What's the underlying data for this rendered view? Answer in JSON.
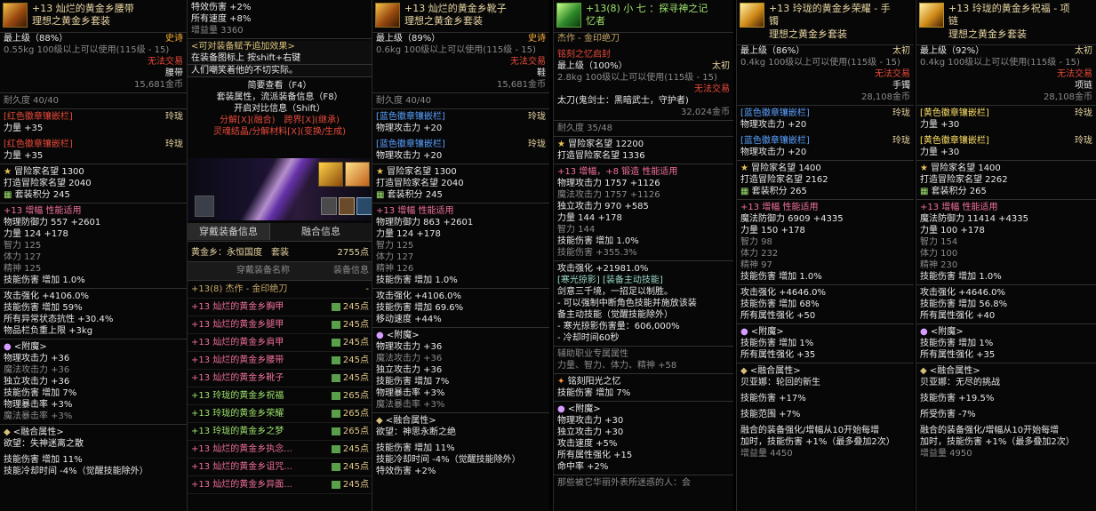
{
  "colors": {
    "background": "#070707",
    "title": "#e9d6a3",
    "red": "#e84a3a",
    "pink": "#f06f9a",
    "green": "#9ee36e",
    "blue": "#5aa0ff",
    "epic": "#ffb23a",
    "teal": "#9ad7c8"
  },
  "panels": [
    {
      "icon": "belt-icon",
      "title": "+13 灿烂的黄金乡腰带",
      "subtitle": "理想之黄金乡套装",
      "lines": [
        {
          "t": "最上级（88%）",
          "c": "white",
          "r": "史诗",
          "rc": "epic"
        },
        {
          "t": "0.55kg 100级以上可以使用(115级 - 15)",
          "c": "grey"
        },
        {
          "t": "",
          "r": "无法交易",
          "rc": "red"
        },
        {
          "t": "",
          "r": "腰带",
          "rc": "white"
        },
        {
          "t": "",
          "r": "15,681金币",
          "rc": "grey"
        },
        {
          "sep": true
        },
        {
          "t": "耐久度 40/40",
          "c": "grey"
        },
        {
          "sep": true
        },
        {
          "t": "[红色徽章镶嵌栏]",
          "c": "red",
          "r": "玲珑",
          "rc": "title"
        },
        {
          "t": "力量 +35",
          "c": "white"
        },
        {
          "gap": true
        },
        {
          "t": "[红色徽章镶嵌栏]",
          "c": "red",
          "r": "玲珑",
          "rc": "title"
        },
        {
          "t": "力量 +35",
          "c": "white"
        },
        {
          "sep": true
        },
        {
          "t": "冒险家名望 1300",
          "c": "white",
          "s": 1
        },
        {
          "t": "   打造冒险家名望 2040",
          "c": "white"
        },
        {
          "t": "套装积分 245",
          "c": "white",
          "s": 2
        },
        {
          "sep": true
        },
        {
          "t": "+13 增幅 性能适用",
          "c": "pink"
        },
        {
          "t": "物理防御力 557 +2601",
          "c": "white"
        },
        {
          "t": "力量 124 +178",
          "c": "white"
        },
        {
          "t": "智力 125",
          "c": "grey"
        },
        {
          "t": "体力 127",
          "c": "grey"
        },
        {
          "t": "精神 125",
          "c": "grey"
        },
        {
          "t": "技能伤害 增加 1.0%",
          "c": "white"
        },
        {
          "sep": true
        },
        {
          "t": "攻击强化 +4106.0%",
          "c": "white"
        },
        {
          "t": "技能伤害 增加 59%",
          "c": "white"
        },
        {
          "t": "所有异常状态抗性 +30.4%",
          "c": "white"
        },
        {
          "t": "物品栏负重上限 +3kg",
          "c": "white"
        },
        {
          "sep": true
        },
        {
          "t": "<附魔>",
          "c": "white",
          "s": 3
        },
        {
          "t": "物理攻击力 +36",
          "c": "white"
        },
        {
          "t": "魔法攻击力 +36",
          "c": "grey"
        },
        {
          "t": "独立攻击力 +36",
          "c": "white"
        },
        {
          "t": "技能伤害 增加 7%",
          "c": "white"
        },
        {
          "t": "物理暴击率 +3%",
          "c": "white"
        },
        {
          "t": "魔法暴击率 +3%",
          "c": "grey"
        },
        {
          "sep": true
        },
        {
          "t": "<融合属性>",
          "c": "white",
          "s": 4
        },
        {
          "t": "   欲望：失神迷离之散",
          "c": "white"
        },
        {
          "gap": true
        },
        {
          "t": "技能伤害 增加 11%",
          "c": "white"
        },
        {
          "t": "技能冷却时间 -4%（觉醒技能除外）",
          "c": "white"
        }
      ]
    },
    {
      "icon": "boots-icon",
      "title": "+13 灿烂的黄金乡靴子",
      "subtitle": "理想之黄金乡套装",
      "lines": [
        {
          "t": "最上级（89%）",
          "c": "white",
          "r": "史诗",
          "rc": "epic"
        },
        {
          "t": "0.6kg 100级以上可以使用(115级 - 15)",
          "c": "grey"
        },
        {
          "t": "",
          "r": "无法交易",
          "rc": "red"
        },
        {
          "t": "",
          "r": "鞋",
          "rc": "white"
        },
        {
          "t": "",
          "r": "15,681金币",
          "rc": "grey"
        },
        {
          "sep": true
        },
        {
          "t": "耐久度 40/40",
          "c": "grey"
        },
        {
          "sep": true
        },
        {
          "t": "[蓝色徽章镶嵌栏]",
          "c": "blue",
          "r": "玲珑",
          "rc": "title"
        },
        {
          "t": "物理攻击力 +20",
          "c": "white"
        },
        {
          "gap": true
        },
        {
          "t": "[蓝色徽章镶嵌栏]",
          "c": "blue",
          "r": "玲珑",
          "rc": "title"
        },
        {
          "t": "物理攻击力 +20",
          "c": "white"
        },
        {
          "sep": true
        },
        {
          "t": "冒险家名望 1300",
          "c": "white",
          "s": 1
        },
        {
          "t": "   打造冒险家名望 2040",
          "c": "white"
        },
        {
          "t": "套装积分 245",
          "c": "white",
          "s": 2
        },
        {
          "sep": true
        },
        {
          "t": "+13 增幅 性能适用",
          "c": "pink"
        },
        {
          "t": "物理防御力 863 +2601",
          "c": "white"
        },
        {
          "t": "力量 124 +178",
          "c": "white"
        },
        {
          "t": "智力 125",
          "c": "grey"
        },
        {
          "t": "体力 127",
          "c": "grey"
        },
        {
          "t": "精神 126",
          "c": "grey"
        },
        {
          "t": "技能伤害 增加 1.0%",
          "c": "white"
        },
        {
          "sep": true
        },
        {
          "t": "攻击强化 +4106.0%",
          "c": "white"
        },
        {
          "t": "技能伤害 增加 69.6%",
          "c": "white"
        },
        {
          "t": "移动速度 +44%",
          "c": "white"
        },
        {
          "sep": true
        },
        {
          "t": "<附魔>",
          "c": "white",
          "s": 3
        },
        {
          "t": "物理攻击力 +36",
          "c": "white"
        },
        {
          "t": "魔法攻击力 +36",
          "c": "grey"
        },
        {
          "t": "独立攻击力 +36",
          "c": "white"
        },
        {
          "t": "技能伤害 增加 7%",
          "c": "white"
        },
        {
          "t": "物理暴击率 +3%",
          "c": "white"
        },
        {
          "t": "魔法暴击率 +3%",
          "c": "grey"
        },
        {
          "sep": true
        },
        {
          "t": "<融合属性>",
          "c": "white",
          "s": 4
        },
        {
          "t": "   欲望：神思永断之绝",
          "c": "white"
        },
        {
          "gap": true
        },
        {
          "t": "技能伤害 增加 11%",
          "c": "white"
        },
        {
          "t": "技能冷却时间 -4%（觉醒技能除外）",
          "c": "white"
        },
        {
          "t": "特效伤害 +2%",
          "c": "white"
        }
      ]
    },
    {
      "icon": "weapon-icon",
      "title": "+13(8) 小 七 ：探寻神之记",
      "subtitle": "忆者",
      "lines": [
        {
          "t": "   杰作 - 金印绝刀",
          "c": "tan"
        },
        {
          "gap": true
        },
        {
          "t": "   铭刻之忆启封",
          "c": "red"
        },
        {
          "t": "最上级（100%）",
          "c": "white",
          "r": "太初",
          "rc": "title"
        },
        {
          "t": "2.8kg 100级以上可以使用(115级 - 15)",
          "c": "grey"
        },
        {
          "t": "",
          "r": "无法交易",
          "rc": "red"
        },
        {
          "t": "太刀(鬼剑士：黑暗武士，守护者)",
          "c": "white"
        },
        {
          "t": "",
          "r": "32,024金币",
          "rc": "grey"
        },
        {
          "sep": true
        },
        {
          "t": "耐久度 35/48",
          "c": "grey"
        },
        {
          "sep": true
        },
        {
          "t": "冒险家名望 12200",
          "c": "white",
          "s": 1
        },
        {
          "t": "   打造冒险家名望 1336",
          "c": "white"
        },
        {
          "sep": true
        },
        {
          "t": "+13 增幅，+8 锻造 性能适用",
          "c": "pink"
        },
        {
          "t": "物理攻击力 1757 +1126",
          "c": "white"
        },
        {
          "t": "魔法攻击力 1757 +1126",
          "c": "grey"
        },
        {
          "t": "独立攻击力 970 +585",
          "c": "white"
        },
        {
          "t": "力量 144 +178",
          "c": "white"
        },
        {
          "t": "智力 144",
          "c": "grey"
        },
        {
          "t": "技能伤害 增加 1.0%",
          "c": "white"
        },
        {
          "t": "技能伤害 +355.3%",
          "c": "grey"
        },
        {
          "sep": true
        },
        {
          "t": "攻击强化 +21981.0%",
          "c": "white"
        },
        {
          "t": "[寒光掠影] [装备主动技能]",
          "c": "teal"
        },
        {
          "t": "剑意三千境，一招足以制胜。",
          "c": "white"
        },
        {
          "t": "- 可以强制中断角色技能并施放该装",
          "c": "white"
        },
        {
          "t": "备主动技能（觉醒技能除外）",
          "c": "white"
        },
        {
          "t": "- 寒光掠影伤害量：606,000%",
          "c": "white"
        },
        {
          "t": "- 冷却时间60秒",
          "c": "white"
        },
        {
          "sep": true
        },
        {
          "t": "辅助职业专属属性",
          "c": "grey"
        },
        {
          "t": "力量、智力、体力、精神 +58",
          "c": "grey"
        },
        {
          "sep": true
        },
        {
          "t": "铭刻阳光之忆",
          "c": "white",
          "s": 5
        },
        {
          "t": "技能伤害 增加 7%",
          "c": "white"
        },
        {
          "sep": true
        },
        {
          "t": "<附魔>",
          "c": "white",
          "s": 3
        },
        {
          "t": "物理攻击力 +30",
          "c": "white"
        },
        {
          "t": "独立攻击力 +30",
          "c": "white"
        },
        {
          "t": "攻击速度 +5%",
          "c": "white"
        },
        {
          "t": "所有属性强化 +15",
          "c": "white"
        },
        {
          "t": "命中率 +2%",
          "c": "white"
        },
        {
          "sep": true
        },
        {
          "t": "那些被它华丽外表所迷惑的人：会",
          "c": "grey"
        }
      ]
    },
    {
      "icon": "bracelet-icon",
      "title": "+13 玲珑的黄金乡荣耀 - 手",
      "subtitle": "镯",
      "subtitle2": "理想之黄金乡套装",
      "lines": [
        {
          "t": "最上级（86%）",
          "c": "white",
          "r": "太初",
          "rc": "title"
        },
        {
          "t": "0.4kg 100级以上可以使用(115级 - 15)",
          "c": "grey"
        },
        {
          "t": "",
          "r": "无法交易",
          "rc": "red"
        },
        {
          "t": "",
          "r": "手镯",
          "rc": "white"
        },
        {
          "t": "",
          "r": "28,108金币",
          "rc": "grey"
        },
        {
          "sep": true
        },
        {
          "t": "[蓝色徽章镶嵌栏]",
          "c": "blue",
          "r": "玲珑",
          "rc": "title"
        },
        {
          "t": "物理攻击力 +20",
          "c": "white"
        },
        {
          "gap": true
        },
        {
          "t": "[蓝色徽章镶嵌栏]",
          "c": "blue",
          "r": "玲珑",
          "rc": "title"
        },
        {
          "t": "物理攻击力 +20",
          "c": "white"
        },
        {
          "sep": true
        },
        {
          "t": "冒险家名望 1400",
          "c": "white",
          "s": 1
        },
        {
          "t": "   打造冒险家名望 2162",
          "c": "white"
        },
        {
          "t": "套装积分 265",
          "c": "white",
          "s": 2
        },
        {
          "sep": true
        },
        {
          "t": "+13 增幅 性能适用",
          "c": "pink"
        },
        {
          "t": "魔法防御力 6909 +4335",
          "c": "white"
        },
        {
          "t": "力量 150 +178",
          "c": "white"
        },
        {
          "t": "智力 98",
          "c": "grey"
        },
        {
          "t": "体力 232",
          "c": "grey"
        },
        {
          "t": "精神 97",
          "c": "grey"
        },
        {
          "t": "技能伤害 增加 1.0%",
          "c": "white"
        },
        {
          "sep": true
        },
        {
          "t": "攻击强化 +4646.0%",
          "c": "white"
        },
        {
          "t": "技能伤害 增加 68%",
          "c": "white"
        },
        {
          "t": "所有属性强化 +50",
          "c": "white"
        },
        {
          "sep": true
        },
        {
          "t": "<附魔>",
          "c": "white",
          "s": 3
        },
        {
          "t": "技能伤害 增加 1%",
          "c": "white"
        },
        {
          "t": "所有属性强化 +35",
          "c": "white"
        },
        {
          "sep": true
        },
        {
          "t": "<融合属性>",
          "c": "white",
          "s": 4
        },
        {
          "t": "   贝亚娜：轮回的新生",
          "c": "white"
        },
        {
          "gap": true
        },
        {
          "t": "技能伤害 +17%",
          "c": "white"
        },
        {
          "gap": true
        },
        {
          "t": "技能范围 +7%",
          "c": "white"
        },
        {
          "gap": true
        },
        {
          "t": "融合的装备强化/增幅从10开始每增",
          "c": "white"
        },
        {
          "t": "加时，技能伤害 +1%（最多叠加2次）",
          "c": "white"
        },
        {
          "t": "增益量 4450",
          "c": "grey"
        }
      ]
    },
    {
      "icon": "necklace-icon",
      "title": "+13 玲珑的黄金乡祝福 - 项",
      "subtitle": "链",
      "subtitle2": "理想之黄金乡套装",
      "lines": [
        {
          "t": "最上级（92%）",
          "c": "white",
          "r": "太初",
          "rc": "title"
        },
        {
          "t": "0.4kg 100级以上可以使用(115级 - 15)",
          "c": "grey"
        },
        {
          "t": "",
          "r": "无法交易",
          "rc": "red"
        },
        {
          "t": "",
          "r": "项链",
          "rc": "white"
        },
        {
          "t": "",
          "r": "28,108金币",
          "rc": "grey"
        },
        {
          "sep": true
        },
        {
          "t": "[黄色徽章镶嵌栏]",
          "c": "yellow",
          "r": "玲珑",
          "rc": "title"
        },
        {
          "t": "力量 +30",
          "c": "white"
        },
        {
          "gap": true
        },
        {
          "t": "[黄色徽章镶嵌栏]",
          "c": "yellow",
          "r": "玲珑",
          "rc": "title"
        },
        {
          "t": "力量 +30",
          "c": "white"
        },
        {
          "sep": true
        },
        {
          "t": "冒险家名望 1400",
          "c": "white",
          "s": 1
        },
        {
          "t": "   打造冒险家名望 2262",
          "c": "white"
        },
        {
          "t": "套装积分 265",
          "c": "white",
          "s": 2
        },
        {
          "sep": true
        },
        {
          "t": "+13 增幅 性能适用",
          "c": "pink"
        },
        {
          "t": "魔法防御力 11414 +4335",
          "c": "white"
        },
        {
          "t": "力量 100 +178",
          "c": "white"
        },
        {
          "t": "智力 154",
          "c": "grey"
        },
        {
          "t": "体力 100",
          "c": "grey"
        },
        {
          "t": "精神 230",
          "c": "grey"
        },
        {
          "t": "技能伤害 增加 1.0%",
          "c": "white"
        },
        {
          "sep": true
        },
        {
          "t": "攻击强化 +4646.0%",
          "c": "white"
        },
        {
          "t": "技能伤害 增加 56.8%",
          "c": "white"
        },
        {
          "t": "所有属性强化 +40",
          "c": "white"
        },
        {
          "sep": true
        },
        {
          "t": "<附魔>",
          "c": "white",
          "s": 3
        },
        {
          "t": "技能伤害 增加 1%",
          "c": "white"
        },
        {
          "t": "所有属性强化 +35",
          "c": "white"
        },
        {
          "sep": true
        },
        {
          "t": "<融合属性>",
          "c": "white",
          "s": 4
        },
        {
          "t": "   贝亚娜：无尽的挑战",
          "c": "white"
        },
        {
          "gap": true
        },
        {
          "t": "技能伤害 +19.5%",
          "c": "white"
        },
        {
          "gap": true
        },
        {
          "t": "所受伤害 -7%",
          "c": "white"
        },
        {
          "gap": true
        },
        {
          "t": "融合的装备强化/增幅从10开始每增",
          "c": "white"
        },
        {
          "t": "加时，技能伤害 +1%（最多叠加2次）",
          "c": "white"
        },
        {
          "t": "增益量 4950",
          "c": "grey"
        }
      ]
    }
  ],
  "mid": {
    "top_lines": [
      "特效伤害 +2%",
      "所有速度 +8%",
      "增益量 3360"
    ],
    "menu": [
      "<可对装备赋予追加效果>",
      "在装备图标上 按shift+右键",
      "人们嘲笑着他的不切实际。"
    ],
    "tip": [
      "简要查看（F4）",
      "套装属性，流派装备信息（F8）",
      "开启对比信息（Shift）"
    ],
    "tip_red": [
      "分解[X](融合)　跨界[X](继承)",
      "灵魂结晶/分解材料[X](变换/生成)"
    ],
    "tabs": [
      "穿戴装备信息",
      "融合信息"
    ],
    "set_name": "黄金乡：永恒国度　套装",
    "set_points": "2755点",
    "col_name": "穿戴装备名称",
    "col_info": "装备信息",
    "rows": [
      {
        "name": "+13(8) 杰作 - 金印绝刀",
        "c": "tan",
        "pts": "-"
      },
      {
        "name": "+13 灿烂的黄金乡胸甲",
        "c": "pink",
        "pts": "245点"
      },
      {
        "name": "+13 灿烂的黄金乡腿甲",
        "c": "pink",
        "pts": "245点"
      },
      {
        "name": "+13 灿烂的黄金乡肩甲",
        "c": "pink",
        "pts": "245点"
      },
      {
        "name": "+13 灿烂的黄金乡腰带",
        "c": "pink",
        "pts": "245点"
      },
      {
        "name": "+13 灿烂的黄金乡靴子",
        "c": "pink",
        "pts": "245点"
      },
      {
        "name": "+13 玲珑的黄金乡祝福",
        "c": "green",
        "pts": "265点"
      },
      {
        "name": "+13 玲珑的黄金乡荣耀",
        "c": "green",
        "pts": "265点"
      },
      {
        "name": "+13 玲珑的黄金乡之梦",
        "c": "green",
        "pts": "265点"
      },
      {
        "name": "+13 灿烂的黄金乡执念...",
        "c": "pink",
        "pts": "245点"
      },
      {
        "name": "+13 灿烂的黄金乡诅咒...",
        "c": "pink",
        "pts": "245点"
      },
      {
        "name": "+13 灿烂的黄金乡异面...",
        "c": "pink",
        "pts": "245点"
      }
    ]
  }
}
